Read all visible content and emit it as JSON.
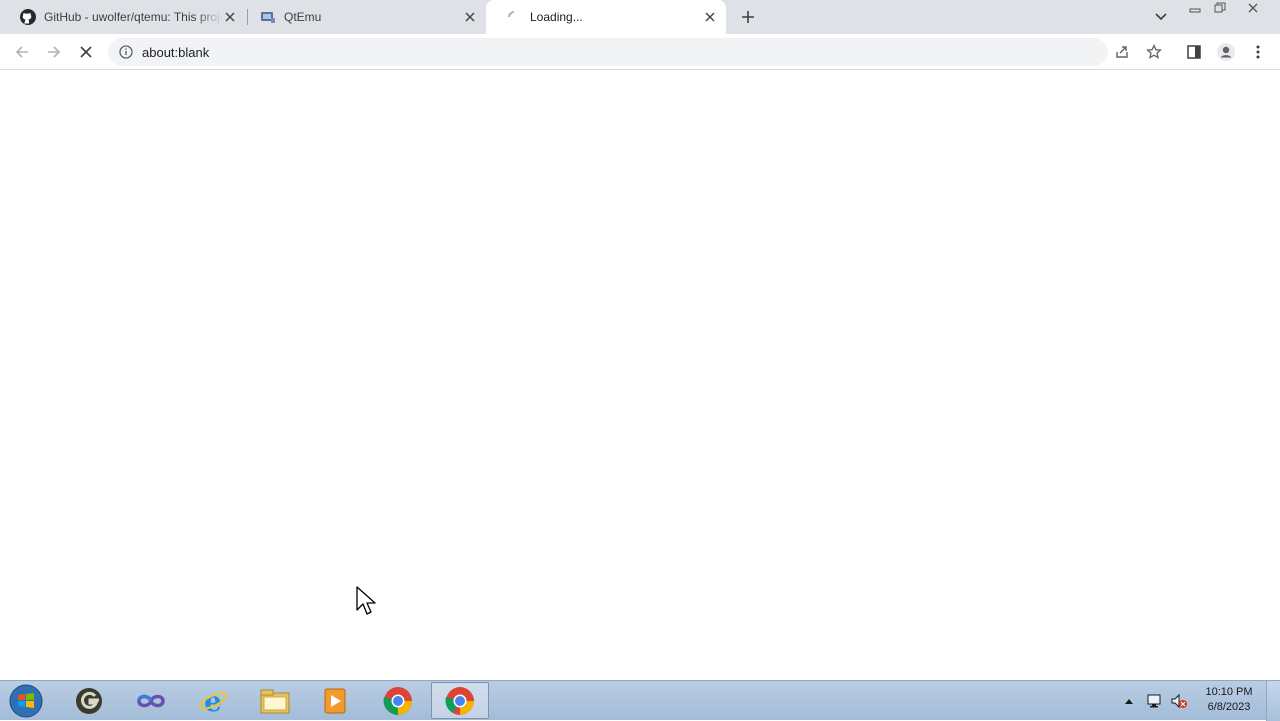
{
  "browser": {
    "tabs": [
      {
        "title": "GitHub - uwolfer/qtemu: This project",
        "icon": "github-icon"
      },
      {
        "title": "QtEmu",
        "icon": "qtemu-icon"
      },
      {
        "title": "Loading...",
        "icon": "loading-spinner-icon",
        "active": true
      }
    ],
    "address": {
      "url": "about:blank",
      "info_icon": "info-icon"
    },
    "toolbar_icons": [
      "back-icon",
      "forward-icon",
      "stop-icon",
      "share-icon",
      "star-icon",
      "side-panel-icon",
      "profile-icon",
      "menu-icon"
    ]
  },
  "taskbar": {
    "apps": [
      "start-orb",
      "gimp-icon",
      "visual-studio-icon",
      "internet-explorer-icon",
      "file-explorer-icon",
      "media-player-icon",
      "chrome-icon",
      "chrome-icon"
    ],
    "clock": {
      "time": "10:10 PM",
      "date": "6/8/2023"
    }
  },
  "colors": {
    "tabstrip": "#dee1e6",
    "omnibox": "#f1f3f4",
    "taskbar": "#a3bcd8"
  }
}
